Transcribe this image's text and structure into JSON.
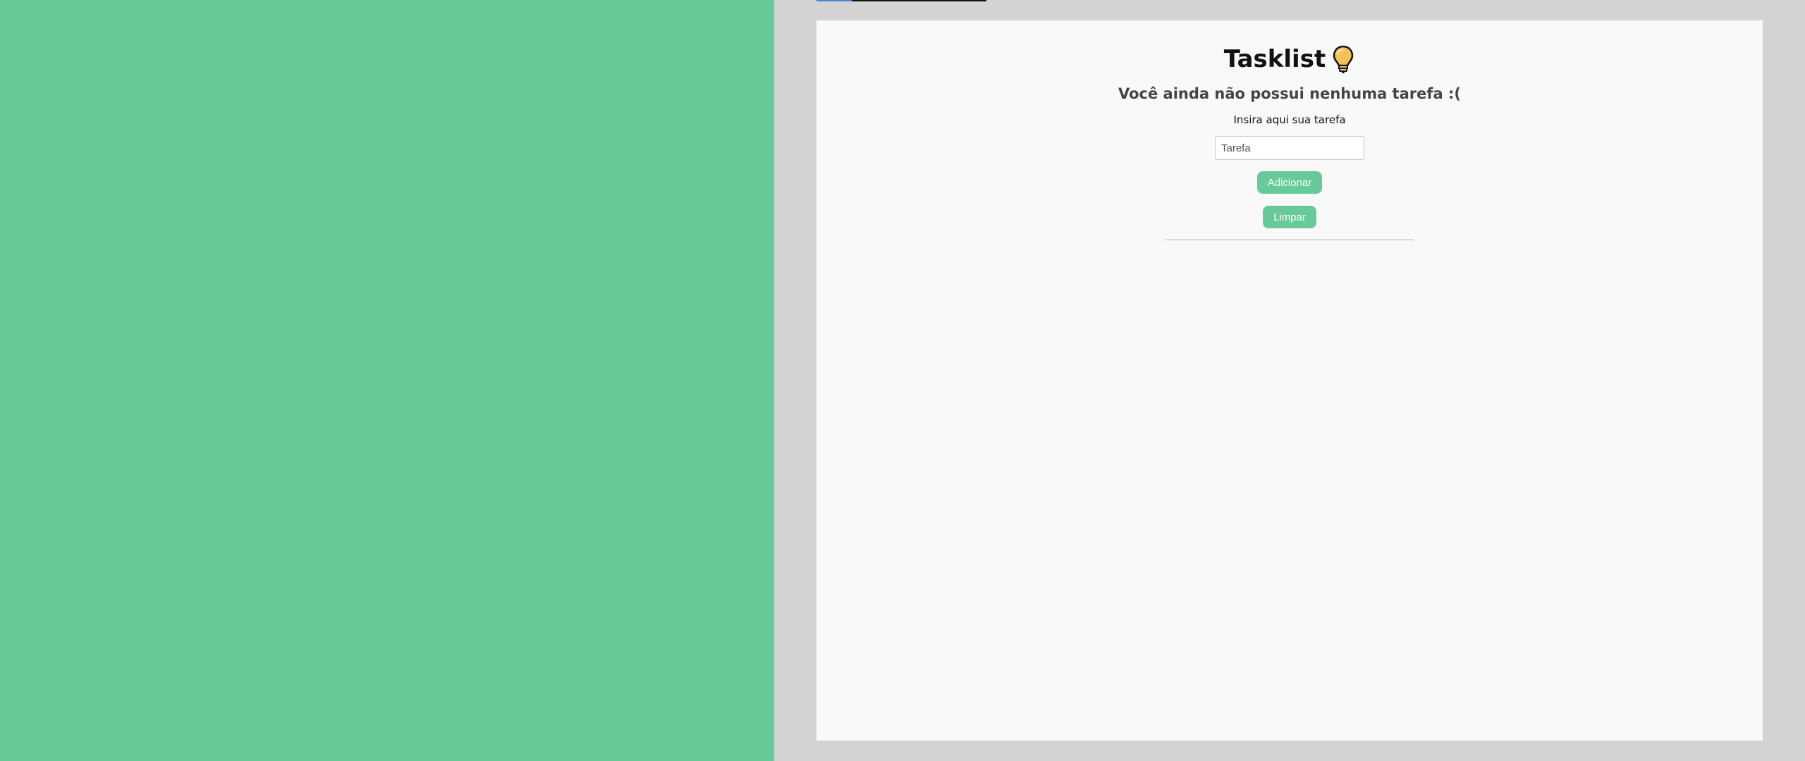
{
  "app": {
    "title": "Tasklist",
    "title_icon": "lightbulb-icon",
    "empty_message": "Você ainda não possui nenhuma tarefa :(",
    "input_label": "Insira aqui sua tarefa"
  },
  "form": {
    "task_placeholder": "Tarefa",
    "task_value": "",
    "add_label": "Adicionar",
    "clear_label": "Limpar"
  },
  "colors": {
    "accent": "#68c999",
    "panel_background": "#d3d3d3",
    "card_background": "#f9f9f9",
    "bulb": "#f5c15a"
  }
}
